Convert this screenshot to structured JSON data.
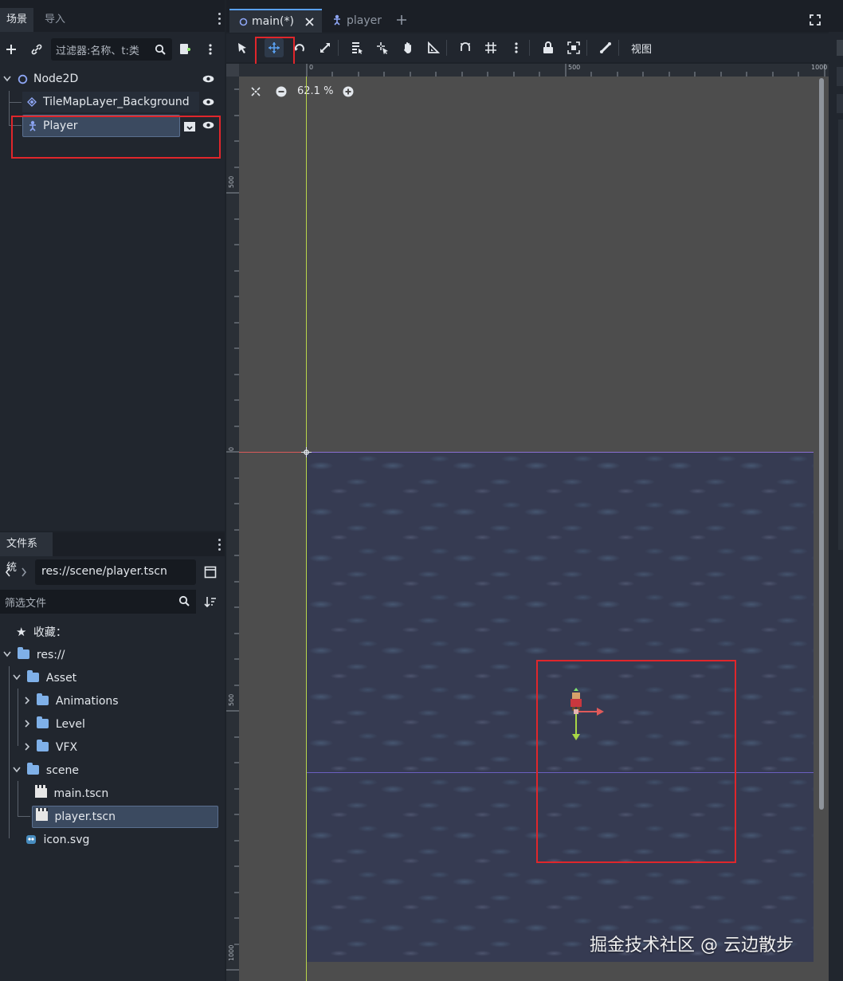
{
  "scene_dock": {
    "tabs": [
      "场景",
      "导入"
    ],
    "filter_placeholder": "过滤器:名称、t:类",
    "nodes": [
      {
        "name": "Node2D"
      },
      {
        "name": "TileMapLayer_Background"
      },
      {
        "name": "Player"
      }
    ]
  },
  "filesystem_dock": {
    "tab": "文件系统",
    "path": "res://scene/player.tscn",
    "filter_placeholder": "筛选文件",
    "items": [
      {
        "label": "收藏："
      },
      {
        "label": "res://"
      },
      {
        "label": "Asset"
      },
      {
        "label": "Animations"
      },
      {
        "label": "Level"
      },
      {
        "label": "VFX"
      },
      {
        "label": "scene"
      },
      {
        "label": "main.tscn"
      },
      {
        "label": "player.tscn"
      },
      {
        "label": "icon.svg"
      }
    ]
  },
  "editor": {
    "tabs": [
      {
        "label": "main(*)"
      },
      {
        "label": "player"
      }
    ],
    "toolbar": {
      "view_label": "视图"
    },
    "zoom": "62.1 %",
    "ruler_top": [
      "0",
      "500",
      "1000"
    ],
    "ruler_left": [
      "500",
      "0",
      "500",
      "1000"
    ],
    "ruler_origin": "0"
  },
  "watermark": "掘金技术社区 @ 云边散步",
  "colors": {
    "highlight_red": "#e0262b",
    "accent_blue": "#5aa0f0",
    "x_axis": "#e05a5a",
    "y_axis": "#a8d646"
  }
}
